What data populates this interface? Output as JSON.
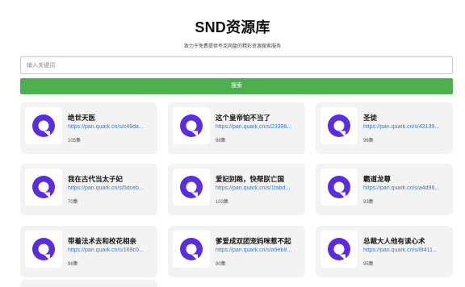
{
  "header": {
    "title": "SND资源库",
    "subtitle": "致力于免费提供夸克网盘的精彩资源搜索服务"
  },
  "search": {
    "placeholder": "输入关键词",
    "button_label": "搜索"
  },
  "colors": {
    "button_bg": "#4caf50",
    "link": "#3b78c4",
    "card_bg": "#f3f3f3",
    "logo_purple": "#5b2de1"
  },
  "results": [
    {
      "title": "绝世天医",
      "link": "https://pan.quark.cn/s/c49da...",
      "count": "105集",
      "icon": "quark-logo-icon"
    },
    {
      "title": "这个皇帝铂不当了",
      "link": "https://pan.quark.cn/s/23396...",
      "count": "98集",
      "icon": "quark-logo-icon"
    },
    {
      "title": "圣徒",
      "link": "https://pan.quark.cn/s/43139...",
      "count": "96集",
      "icon": "quark-logo-icon"
    },
    {
      "title": "我在古代当太子妃",
      "link": "https://pan.quark.cn/s/5dceb...",
      "count": "70集",
      "icon": "quark-logo-icon"
    },
    {
      "title": "爱妃别跑，快帮朕亡国",
      "link": "https://pan.quark.cn/s/1fabd...",
      "count": "103集",
      "icon": "quark-logo-icon"
    },
    {
      "title": "霸道龙尊",
      "link": "https://pan.quark.cn/s/a4d96...",
      "count": "93集",
      "icon": "quark-logo-icon"
    },
    {
      "title": "带着法术去和校花相亲",
      "link": "https://pan.quark.cn/s/169c0...",
      "count": "96集",
      "icon": "quark-logo-icon"
    },
    {
      "title": "爹爱成双团宠妈咪惹不起",
      "link": "https://pan.quark.cn/s/a9eb8...",
      "count": "80集",
      "icon": "quark-logo-icon"
    },
    {
      "title": "总裁大人他有读心术",
      "link": "https://pan.quark.cn/s/8f411...",
      "count": "95集",
      "icon": "quark-logo-icon"
    }
  ]
}
